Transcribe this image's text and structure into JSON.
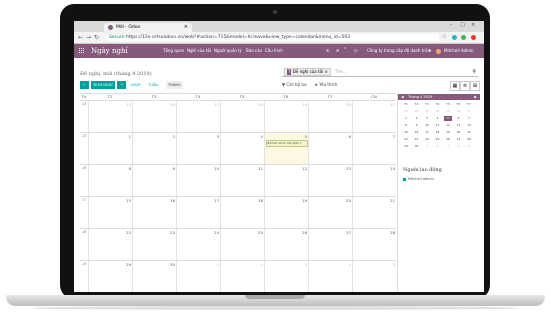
{
  "browser": {
    "tab_title": "Mời - Odoo",
    "url_secure": "Secure",
    "url": "https://12e.ortsolution.vn/web?#action=715&model=hr.leave&view_type=calendar&menu_id=503"
  },
  "topbar": {
    "app_title": "Ngày nghỉ",
    "menu": [
      "Tổng quan",
      "Nghỉ của tôi",
      "Người quản lý",
      "Báo cáo",
      "Cấu hình"
    ],
    "company": "Công ty trang cấp độ danh trả",
    "user": "Mitchell Admin",
    "chat_count": "1"
  },
  "control_panel": {
    "breadcrumb": "Đề nghị, mới (tháng 4 2019)",
    "create_button": "ĐOM NGHỈ",
    "scale_day": "NGÀY",
    "scale_week": "TUẦN",
    "scale_month": "THÁNG",
    "search_facet_tag": "T",
    "search_facet": "Đề nghị của tôi",
    "search_placeholder": "Tìm...",
    "filters_label": "Các bộ lọc",
    "groupby_label": "Yêu thích"
  },
  "calendar": {
    "headers": [
      "Th",
      "T2",
      "T3",
      "T4",
      "T5",
      "T6",
      "T7",
      "CN"
    ],
    "weeks": [
      {
        "num": "14",
        "days": [
          {
            "d": "25",
            "o": true
          },
          {
            "d": "26",
            "o": true
          },
          {
            "d": "27",
            "o": true
          },
          {
            "d": "28",
            "o": true
          },
          {
            "d": "29",
            "o": true
          },
          {
            "d": "30",
            "o": true
          },
          {
            "d": "31",
            "o": true
          }
        ]
      },
      {
        "num": "15",
        "days": [
          {
            "d": "1"
          },
          {
            "d": "2"
          },
          {
            "d": "3"
          },
          {
            "d": "4"
          },
          {
            "d": "5",
            "today": true
          },
          {
            "d": "6"
          },
          {
            "d": "7"
          }
        ]
      },
      {
        "num": "16",
        "days": [
          {
            "d": "8"
          },
          {
            "d": "9"
          },
          {
            "d": "10"
          },
          {
            "d": "11"
          },
          {
            "d": "12"
          },
          {
            "d": "13"
          },
          {
            "d": "14"
          }
        ]
      },
      {
        "num": "17",
        "days": [
          {
            "d": "15"
          },
          {
            "d": "16"
          },
          {
            "d": "17"
          },
          {
            "d": "18"
          },
          {
            "d": "19"
          },
          {
            "d": "20"
          },
          {
            "d": "21"
          }
        ]
      },
      {
        "num": "18",
        "days": [
          {
            "d": "22"
          },
          {
            "d": "23"
          },
          {
            "d": "24"
          },
          {
            "d": "25"
          },
          {
            "d": "26"
          },
          {
            "d": "27"
          },
          {
            "d": "28"
          }
        ]
      },
      {
        "num": "19",
        "days": [
          {
            "d": "29"
          },
          {
            "d": "30"
          },
          {
            "d": "1",
            "o": true
          },
          {
            "d": "2",
            "o": true
          },
          {
            "d": "3",
            "o": true
          },
          {
            "d": "4",
            "o": true
          },
          {
            "d": "5",
            "o": true
          }
        ]
      }
    ],
    "event": "Mitchell Admin trên Nghỉ 1"
  },
  "mini_calendar": {
    "title": "Tháng 4 2019",
    "dow": [
      "Th",
      "T2",
      "T3",
      "T4",
      "T5",
      "T6",
      "T7"
    ],
    "rows": [
      [
        {
          "d": "25",
          "o": true
        },
        {
          "d": "26",
          "o": true
        },
        {
          "d": "27",
          "o": true
        },
        {
          "d": "28",
          "o": true
        },
        {
          "d": "29",
          "o": true
        },
        {
          "d": "30",
          "o": true
        },
        {
          "d": "31",
          "o": true
        }
      ],
      [
        {
          "d": "1"
        },
        {
          "d": "2"
        },
        {
          "d": "3"
        },
        {
          "d": "4"
        },
        {
          "d": "5",
          "sel": true
        },
        {
          "d": "6"
        },
        {
          "d": "7"
        }
      ],
      [
        {
          "d": "8"
        },
        {
          "d": "9"
        },
        {
          "d": "10"
        },
        {
          "d": "11"
        },
        {
          "d": "12"
        },
        {
          "d": "13"
        },
        {
          "d": "14"
        }
      ],
      [
        {
          "d": "15"
        },
        {
          "d": "16"
        },
        {
          "d": "17"
        },
        {
          "d": "18"
        },
        {
          "d": "19"
        },
        {
          "d": "20"
        },
        {
          "d": "21"
        }
      ],
      [
        {
          "d": "22"
        },
        {
          "d": "23"
        },
        {
          "d": "24"
        },
        {
          "d": "25"
        },
        {
          "d": "26"
        },
        {
          "d": "27"
        },
        {
          "d": "28"
        }
      ],
      [
        {
          "d": "29"
        },
        {
          "d": "30"
        },
        {
          "d": "1",
          "o": true
        },
        {
          "d": "2",
          "o": true
        },
        {
          "d": "3",
          "o": true
        },
        {
          "d": "4",
          "o": true
        },
        {
          "d": "5",
          "o": true
        }
      ]
    ]
  },
  "sidebar": {
    "title": "Người lao động",
    "employee": "Mitchell Admin"
  },
  "colors": {
    "brand": "#875a7b",
    "accent": "#00a09d"
  }
}
